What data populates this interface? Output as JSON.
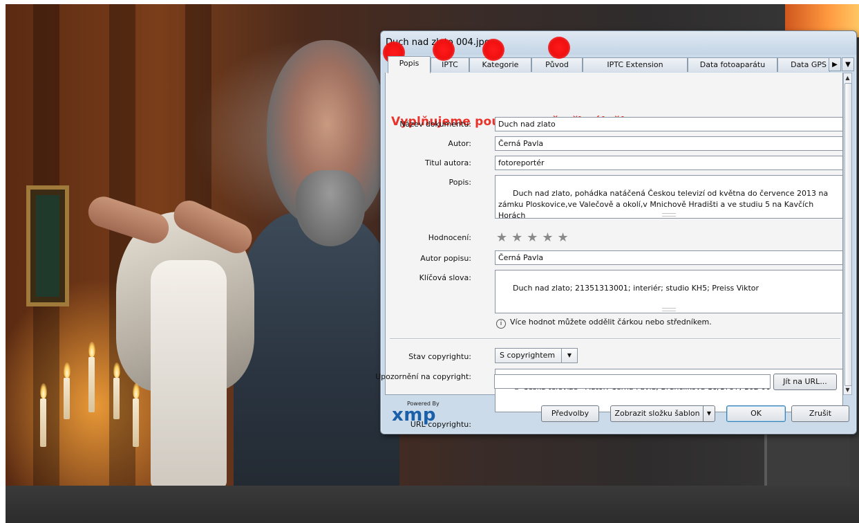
{
  "dialog": {
    "title": "Duch nad zlato 004.jpg",
    "tabs": [
      {
        "label": "Popis",
        "active": true
      },
      {
        "label": "IPTC"
      },
      {
        "label": "Kategorie"
      },
      {
        "label": "Původ"
      },
      {
        "label": "IPTC Extension"
      },
      {
        "label": "Data fotoaparátu"
      },
      {
        "label": "Data GPS"
      }
    ],
    "tab_next_icon": "triangle-right-icon",
    "tab_menu_icon": "chevron-down-icon",
    "hint": "Vyplňujeme pouze  tyto čtyři záložky.",
    "fields": {
      "document_title": {
        "label": "Název dokumentu:",
        "value": "Duch nad zlato"
      },
      "author": {
        "label": "Autor:",
        "value": "Černá Pavla"
      },
      "author_title": {
        "label": "Titul autora:",
        "value": "fotoreportér"
      },
      "description": {
        "label": "Popis:",
        "value": "Duch nad zlato, pohádka natáčená Českou televizí od května do července 2013 na zámku Ploskovice,ve Valečově a okolí,v Mnichově Hradišti a ve studiu 5 na Kavčích Horách"
      },
      "rating": {
        "label": "Hodnocení:",
        "stars": "★★★★★",
        "value": 0
      },
      "description_writer": {
        "label": "Autor popisu:",
        "value": "Černá Pavla"
      },
      "keywords": {
        "label": "Klíčová slova:",
        "value": "Duch nad zlato; 21351313001; interiér; studio KH5; Preiss Viktor"
      },
      "keywords_note": "Více hodnot můžete oddělit čárkou nebo středníkem.",
      "copyright_status": {
        "label": "Stav copyrightu:",
        "value": "S copyrightem"
      },
      "copyright_notice": {
        "label": "Upozornění na copyright:",
        "value": "© Česká televize - Autor: Černá Pavla, Brunclíkova 18/1757, 162 00 Praha 6"
      },
      "copyright_url": {
        "label": "URL copyrightu:",
        "value": "",
        "button": "Jít na URL..."
      }
    },
    "footer": {
      "logo_powered": "Powered By",
      "logo_text": "xmp",
      "preferences": "Předvolby",
      "templates": "Zobrazit složku šablon",
      "ok": "OK",
      "cancel": "Zrušit"
    },
    "colors": {
      "hint": "#e8322a",
      "markers": "#f01010",
      "xmp_logo": "#1b5fa8"
    }
  }
}
